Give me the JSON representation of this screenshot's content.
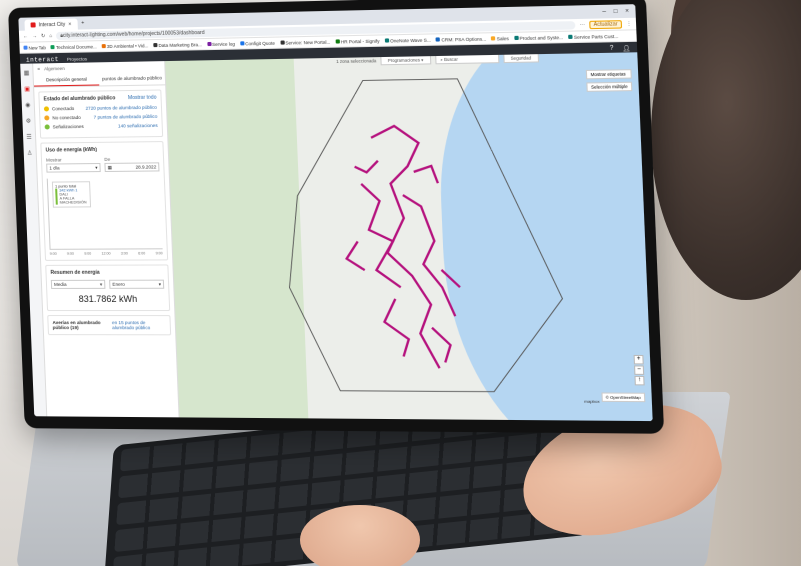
{
  "browser": {
    "tab_title": "Interact City",
    "address": "city.interact-lighting.com/web/home/projects/100053/dashboard",
    "update_button": "Actualizar",
    "window_controls": [
      "–",
      "□",
      "×"
    ],
    "bookmarks": [
      "New Tab",
      "Technical Docume...",
      "3D Ambiental • Vid...",
      "Data Marketing Bra...",
      "Service log",
      "Configit Quote",
      "Service: New Portal...",
      "HR Portal - Signify",
      "OneNote Wave S...",
      "CRM: PSA Options...",
      "Sales",
      "Product and Syste...",
      "Service Parts Cust..."
    ],
    "bookmark_colors": [
      "#4285f4",
      "#0f9d58",
      "#e8710a",
      "#333333",
      "#7b1fa2",
      "#1a73e8",
      "#333333",
      "#107c10",
      "#0b7a75",
      "#1565c0",
      "#f9a825",
      "#0b7a75",
      "#0b7a75"
    ]
  },
  "app": {
    "brand": "interact",
    "section": "Proyectos",
    "panel": {
      "header_label": "Algemeen",
      "tabs": [
        "Descripción general",
        "puntos de alumbrado público"
      ],
      "status_card": {
        "title": "Estado del alumbrado público",
        "link": "Mostrar todo",
        "rows": [
          {
            "label": "Conectado",
            "value": "2720 puntos de alumbrado público",
            "color": "#f0c000"
          },
          {
            "label": "No conectado",
            "value": "7 puntos de alumbrado público",
            "color": "#f5a623"
          },
          {
            "label": "Señalizaciones",
            "value": "140 señalizaciones",
            "color": "#7bbf3b"
          }
        ]
      },
      "energy_card": {
        "title": "Uso de energía (kWh)",
        "field1_label": "Mostrar",
        "field1_value": "1 día",
        "field2_label": "De",
        "field2_value": "28.9.2022",
        "tooltip_title": "1 punto total",
        "tooltip_value": "342 kWh 1",
        "tooltip_sub1": "DALI",
        "tooltip_sub2": "A FALLA MACHEDISIÓN",
        "x_ticks": [
          "9:00",
          "9:00",
          "9:00",
          "12:00",
          "3:00",
          "6:00",
          "9:00"
        ]
      },
      "summary_card": {
        "title": "Resumen de energía",
        "select1": "Media",
        "select2": "Enero",
        "value": "831.7862 kWh"
      },
      "footer": {
        "label": "Averías en alumbrado público (19)",
        "link": "en 15 puntos de alumbrado público"
      }
    },
    "map": {
      "selection_text": "1 zona seleccionada",
      "selector_label": "Programaciones",
      "search_placeholder": "Buscar",
      "tools": [
        "Mostrar etiquetas",
        "Selección múltiple"
      ],
      "top_right_button": "Seguridad",
      "attribution_logo": "mapbox",
      "attribution": "© OpenStreetMap",
      "zoom_in": "+",
      "zoom_out": "−",
      "compass": "↑"
    }
  }
}
